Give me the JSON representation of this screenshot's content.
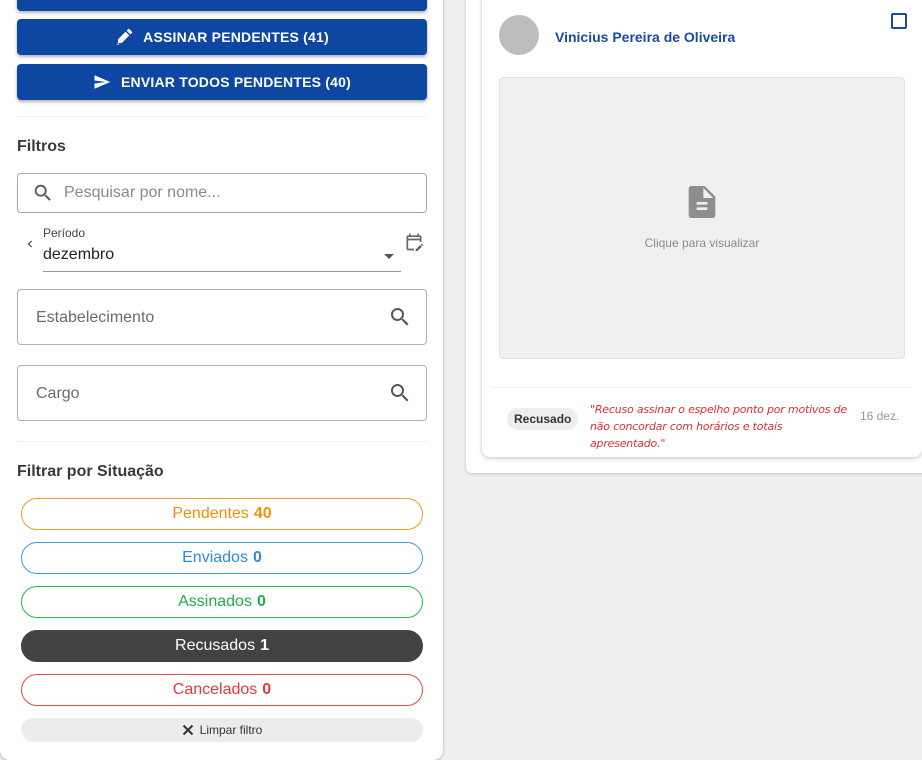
{
  "actions": {
    "sign_pending_label": "ASSINAR PENDENTES (41)",
    "send_all_label": "ENVIAR TODOS PENDENTES (40)"
  },
  "filters": {
    "title": "Filtros",
    "search_placeholder": "Pesquisar por nome...",
    "period_label": "Período",
    "period_value": "dezembro",
    "establishment_label": "Estabelecimento",
    "role_label": "Cargo"
  },
  "status_filter": {
    "title": "Filtrar por Situação",
    "chips": [
      {
        "label": "Pendentes",
        "count": "40",
        "color": "#f0900c"
      },
      {
        "label": "Enviados",
        "count": "0",
        "color": "#2f8ad6"
      },
      {
        "label": "Assinados",
        "count": "0",
        "color": "#1fae48"
      },
      {
        "label": "Recusados",
        "count": "1",
        "color": "#424242",
        "selected": true
      },
      {
        "label": "Cancelados",
        "count": "0",
        "color": "#e03a3a"
      }
    ],
    "clear_label": "Limpar filtro"
  },
  "card": {
    "name": "Vinicius Pereira de Oliveira",
    "preview_text": "Clique para visualizar",
    "status": "Recusado",
    "reason": "\"Recuso assinar o espelho ponto por motivos de não concordar com horários e totais apresentado.\"",
    "date": "16 dez."
  },
  "colors": {
    "primary": "#0d47a1",
    "name_link": "#1a4ba0",
    "refused_text": "#d93232"
  },
  "icons": {
    "sign": "signature-pen-icon",
    "send": "send-icon",
    "search": "search-icon",
    "calendar": "calendar-edit-icon",
    "document": "document-icon",
    "close": "close-icon"
  }
}
